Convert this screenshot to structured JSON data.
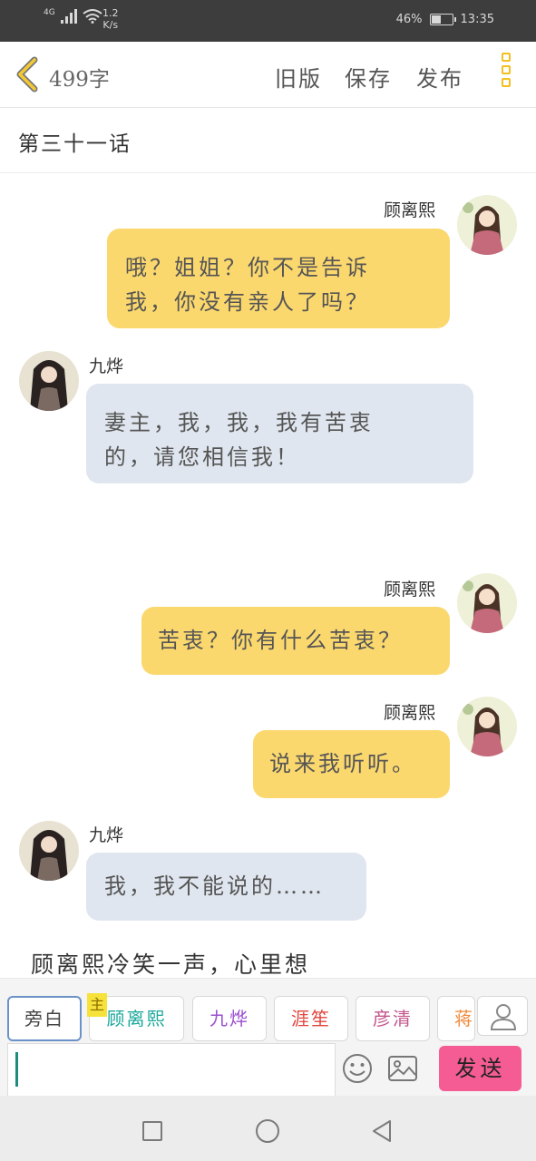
{
  "status_bar": {
    "network": "4G",
    "speed_value": "1.2",
    "speed_unit": "K/s",
    "battery": "46%",
    "battery_level": 0.46,
    "time": "13:35"
  },
  "header": {
    "word_count": "499字",
    "old_version": "旧版",
    "save": "保存",
    "publish": "发布"
  },
  "chapter_title": "第三十一话",
  "messages": [
    {
      "side": "right",
      "speaker": "顾离熙",
      "lines": [
        "哦？姐姐？你不是告诉",
        "我，你没有亲人了吗？"
      ]
    },
    {
      "side": "left",
      "speaker": "九烨",
      "lines": [
        "妻主，我，我，我有苦衷",
        "的，请您相信我！"
      ]
    },
    {
      "side": "right",
      "speaker": "顾离熙",
      "lines": [
        "苦衷？你有什么苦衷？"
      ]
    },
    {
      "side": "right",
      "speaker": "顾离熙",
      "lines": [
        "说来我听听。"
      ]
    },
    {
      "side": "left",
      "speaker": "九烨",
      "lines": [
        "我，我不能说的……"
      ]
    }
  ],
  "narration": "顾离熙冷笑一声，心里想",
  "roles": [
    {
      "label": "旁白",
      "color": "#444444"
    },
    {
      "label": "顾离熙",
      "color": "#1aa89a"
    },
    {
      "label": "九烨",
      "color": "#9b4fd0"
    },
    {
      "label": "涯笙",
      "color": "#e0463c"
    },
    {
      "label": "彦清",
      "color": "#c4568c"
    },
    {
      "label": "蒋",
      "color": "#f08a3c"
    }
  ],
  "main_badge": "主",
  "send_label": "发送",
  "input": {
    "value": ""
  }
}
